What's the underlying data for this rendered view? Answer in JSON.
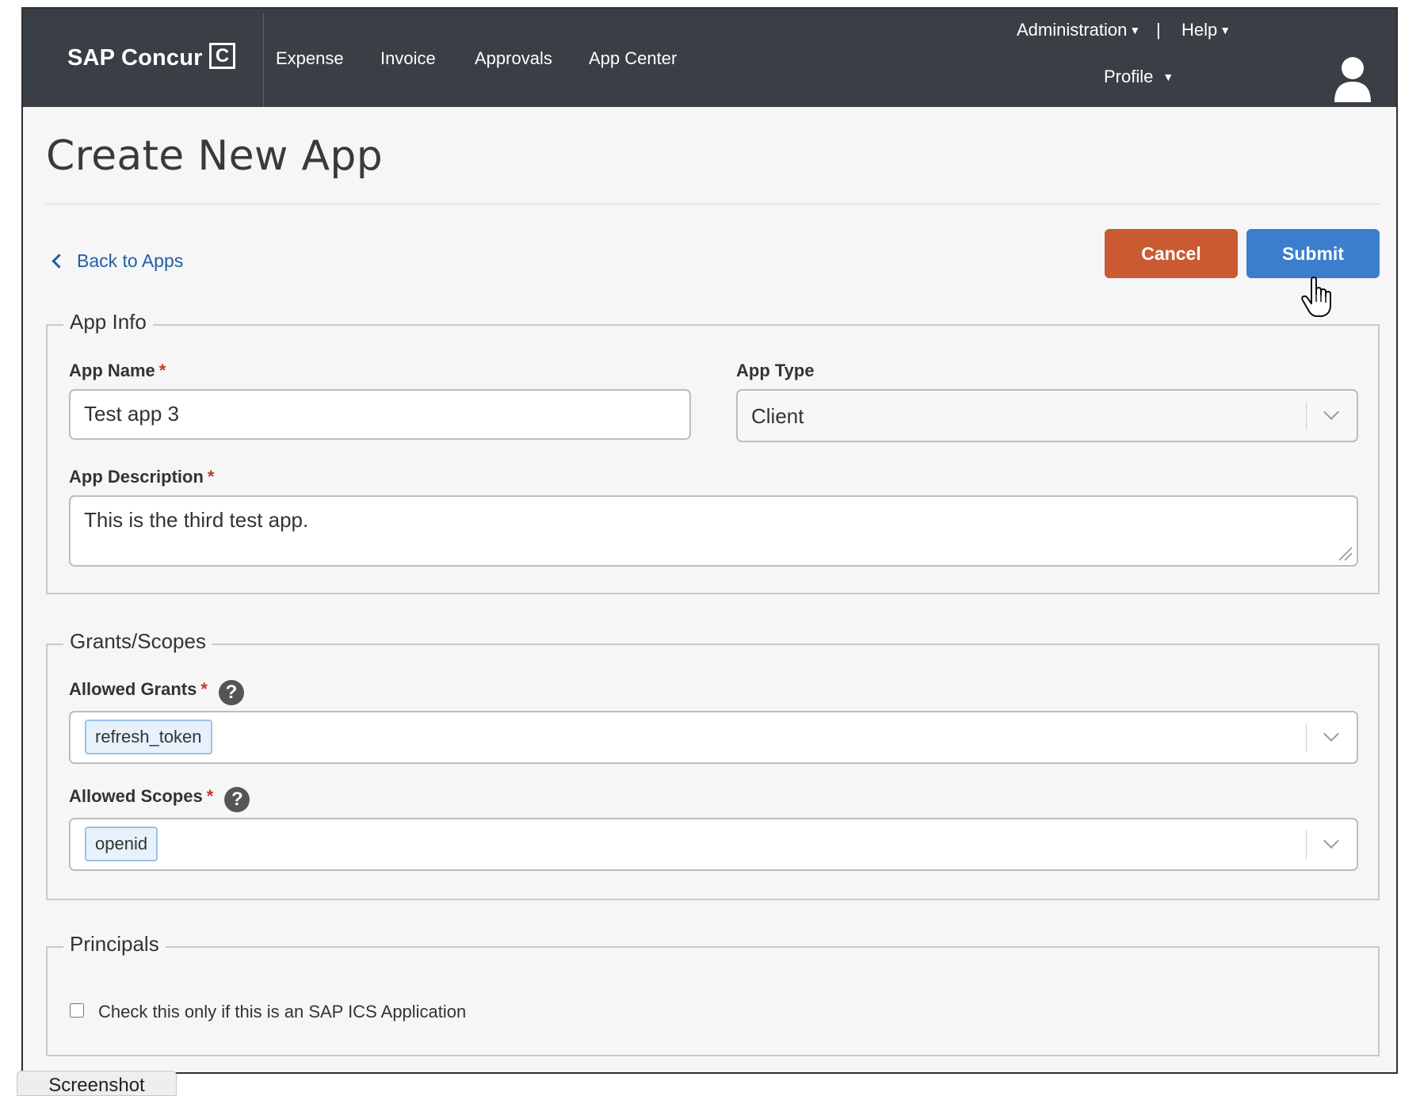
{
  "brand": {
    "name": "SAP Concur",
    "mark": "C"
  },
  "nav": {
    "items": [
      "Expense",
      "Invoice",
      "Approvals",
      "App Center"
    ],
    "administration": "Administration",
    "separator": "|",
    "help": "Help",
    "profile": "Profile"
  },
  "page": {
    "title": "Create New App",
    "back_link": "Back to Apps"
  },
  "actions": {
    "cancel": "Cancel",
    "submit": "Submit"
  },
  "app_info": {
    "legend": "App Info",
    "name_label": "App Name",
    "name_value": "Test app 3",
    "type_label": "App Type",
    "type_value": "Client",
    "description_label": "App Description",
    "description_value": "This is the third test app.",
    "required_mark": "*"
  },
  "grants_scopes": {
    "legend": "Grants/Scopes",
    "grants_label": "Allowed Grants",
    "grants_values": [
      "refresh_token"
    ],
    "scopes_label": "Allowed Scopes",
    "scopes_values": [
      "openid"
    ],
    "required_mark": "*",
    "help_glyph": "?"
  },
  "principals": {
    "legend": "Principals",
    "checkbox_label": "Check this only if this is an SAP ICS Application",
    "checked": false
  },
  "overlay_tab": "Screenshot",
  "colors": {
    "topbar": "#3a3e45",
    "cancel": "#c95a32",
    "submit": "#3b7ecb",
    "link": "#1f5fa8",
    "required": "#c0392b"
  },
  "icons": [
    "user-avatar-icon",
    "chevron-left-icon",
    "chevron-down-icon",
    "question-circle-icon",
    "hand-pointer-icon",
    "resize-handle-icon"
  ]
}
